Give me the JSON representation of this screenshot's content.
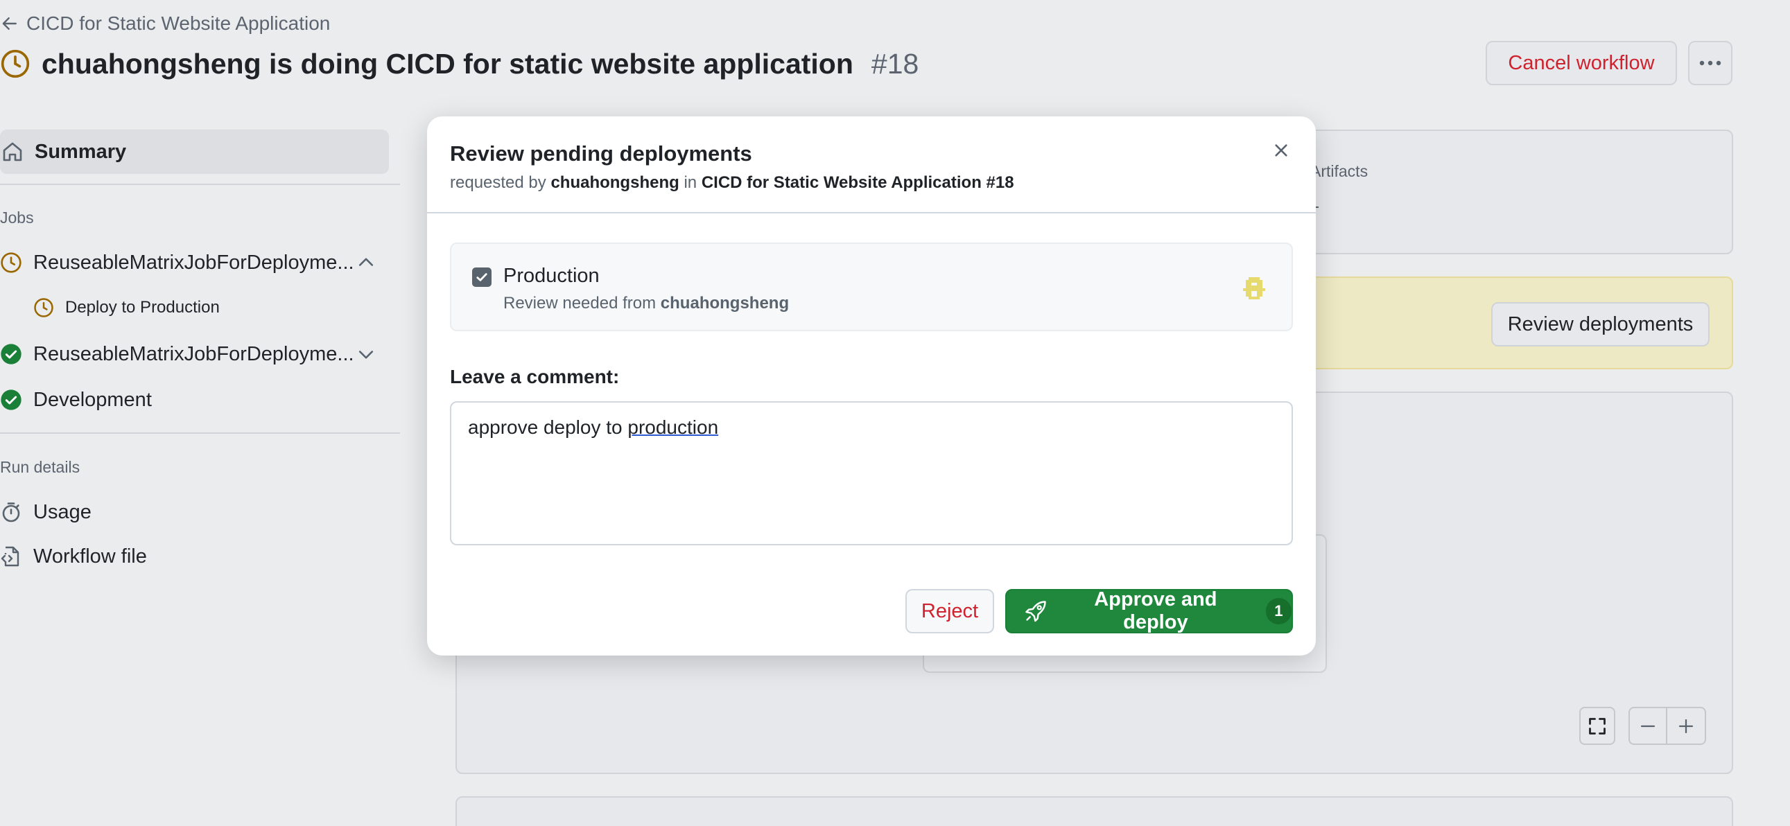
{
  "header": {
    "back_label": "CICD for Static Website Application",
    "title": "chuahongsheng is doing CICD for static website application",
    "run_number": "#18",
    "cancel_label": "Cancel workflow",
    "more_icon": "kebab-horizontal-icon"
  },
  "sidebar": {
    "summary_label": "Summary",
    "jobs_heading": "Jobs",
    "jobs": [
      {
        "label": "ReuseableMatrixJobForDeployme...",
        "status": "pending",
        "expanded": true
      },
      {
        "label": "Deploy to Production",
        "status": "pending"
      },
      {
        "label": "ReuseableMatrixJobForDeployme...",
        "status": "success",
        "expanded": false
      },
      {
        "label": "Development",
        "status": "success"
      }
    ],
    "run_details_heading": "Run details",
    "usage_label": "Usage",
    "workflow_file_label": "Workflow file"
  },
  "background": {
    "artifacts_label": "Artifacts",
    "review_deployments_label": "Review deployments"
  },
  "modal": {
    "title": "Review pending deployments",
    "requested_by_prefix": "requested by",
    "requested_by_user": "chuahongsheng",
    "in_word": "in",
    "workflow_ref": "CICD for Static Website Application #18",
    "environment": {
      "name": "Production",
      "checked": true,
      "review_prefix": "Review needed from",
      "reviewer": "chuahongsheng"
    },
    "comment_label": "Leave a comment:",
    "comment_value_plain": "approve deploy to ",
    "comment_value_underlined": "production",
    "reject_label": "Reject",
    "approve_label": "Approve and deploy",
    "approve_count": "1"
  },
  "colors": {
    "pending": "#9a6700",
    "success": "#1a7f37",
    "danger": "#cf222e",
    "primary": "#1f883d",
    "warning_bg": "#ede9c4"
  }
}
